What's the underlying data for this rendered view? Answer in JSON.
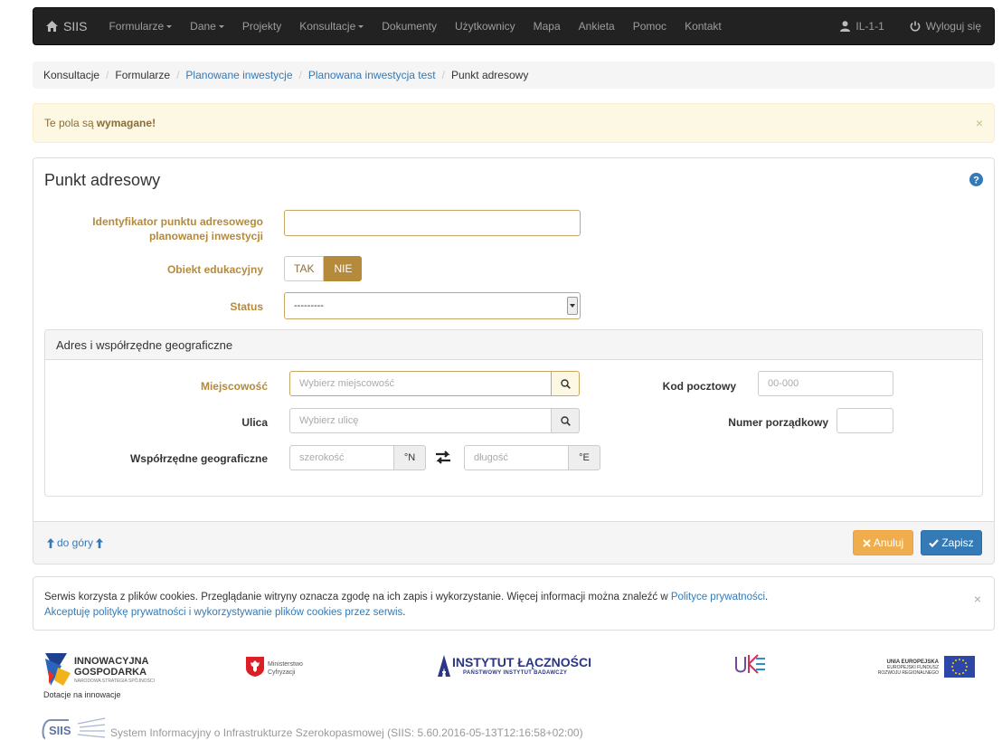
{
  "nav": {
    "brand": "SIIS",
    "items": [
      {
        "label": "Formularze",
        "dropdown": true
      },
      {
        "label": "Dane",
        "dropdown": true
      },
      {
        "label": "Projekty",
        "dropdown": false
      },
      {
        "label": "Konsultacje",
        "dropdown": true
      },
      {
        "label": "Dokumenty",
        "dropdown": false
      },
      {
        "label": "Użytkownicy",
        "dropdown": false
      },
      {
        "label": "Mapa",
        "dropdown": false
      },
      {
        "label": "Ankieta",
        "dropdown": false
      },
      {
        "label": "Pomoc",
        "dropdown": false
      },
      {
        "label": "Kontakt",
        "dropdown": false
      }
    ],
    "user": "IL-1-1",
    "logout": "Wyloguj się"
  },
  "breadcrumb": {
    "items": [
      "Konsultacje",
      "Formularze",
      "Planowane inwestycje",
      "Planowana inwestycja test",
      "Punkt adresowy"
    ]
  },
  "alert": {
    "text": "Te pola są",
    "bold": "wymagane!",
    "close": "×"
  },
  "form": {
    "title": "Punkt adresowy",
    "identifier_label_1": "Identyfikator punktu adresowego",
    "identifier_label_2": "planowanej inwestycji",
    "identifier_value": "",
    "education_label": "Obiekt edukacyjny",
    "education_yes": "TAK",
    "education_no": "NIE",
    "education_selected": "NIE",
    "status_label": "Status",
    "status_value": "---------"
  },
  "address": {
    "title": "Adres i współrzędne geograficzne",
    "city_label": "Miejscowość",
    "city_placeholder": "Wybierz miejscowość",
    "postal_label": "Kod pocztowy",
    "postal_placeholder": "00-000",
    "street_label": "Ulica",
    "street_placeholder": "Wybierz ulicę",
    "number_label": "Numer porządkowy",
    "number_value": "",
    "coords_label": "Współrzędne geograficzne",
    "lat_placeholder": "szerokość",
    "lat_unit": "°N",
    "lon_placeholder": "długość",
    "lon_unit": "°E"
  },
  "footer_actions": {
    "to_top": "do góry",
    "cancel": "Anuluj",
    "save": "Zapisz"
  },
  "cookie": {
    "text": "Serwis korzysta z plików cookies. Przeglądanie witryny oznacza zgodę na ich zapis i wykorzystanie. Więcej informacji można znaleźć w",
    "policy_link": "Polityce prywatności",
    "policy_end": ".",
    "accept_link": "Akceptuję politykę prywatności i wykorzystywanie plików cookies przez serwis",
    "accept_end": ".",
    "close": "×"
  },
  "logos": {
    "ig_1": "INNOWACYJNA",
    "ig_2": "GOSPODARKA",
    "ig_sub": "NARODOWA STRATEGIA SPÓJNOŚCI",
    "ig_caption": "Dotacje na innowacje",
    "mc_1": "Ministerstwo",
    "mc_2": "Cyfryzacji",
    "il_1": "INSTYTUT ŁĄCZNOŚCI",
    "il_2": "PAŃSTWOWY INSTYTUT BADAWCZY",
    "ue_1": "UNIA EUROPEJSKA",
    "ue_2": "EUROPEJSKI FUNDUSZ",
    "ue_3": "ROZWOJU REGIONALNEGO"
  },
  "system_footer": {
    "logo_text": "SIIS",
    "text": "System Informacyjny o Infrastrukturze Szerokopasmowej  (SIIS: 5.60.2016-05-13T12:16:58+02:00)"
  },
  "colors": {
    "navbar": "#222222",
    "required": "#b58a3a",
    "primary": "#337ab7",
    "warning": "#f0ad4e"
  }
}
